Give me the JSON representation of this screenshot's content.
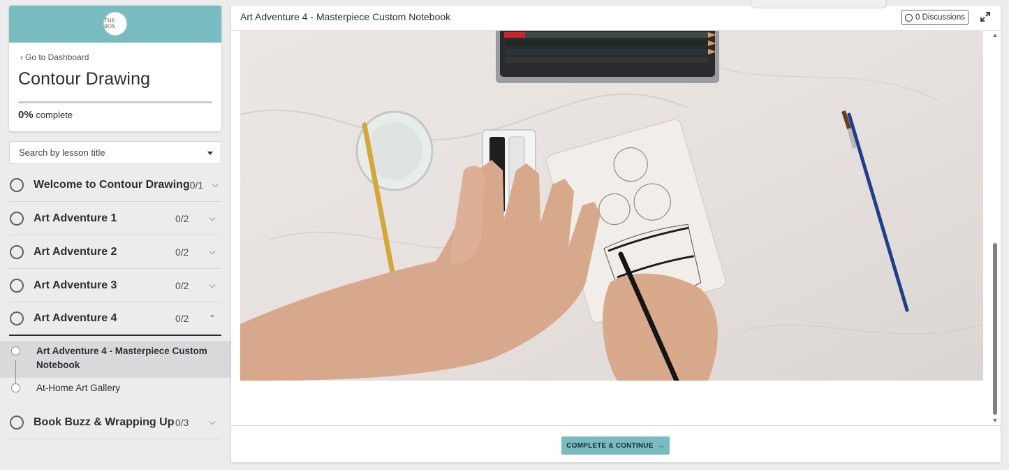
{
  "sidebar": {
    "logo_text": "THE BOX",
    "go_to_dashboard": "Go to Dashboard",
    "course_title": "Contour Drawing",
    "progress_percent": "0%",
    "progress_label": "complete",
    "progress_value": 0,
    "search_placeholder": "Search by lesson title",
    "sections": [
      {
        "title": "Welcome to Contour Drawing",
        "count": "0/1",
        "expanded": false
      },
      {
        "title": "Art Adventure 1",
        "count": "0/2",
        "expanded": false
      },
      {
        "title": "Art Adventure 2",
        "count": "0/2",
        "expanded": false
      },
      {
        "title": "Art Adventure 3",
        "count": "0/2",
        "expanded": false
      },
      {
        "title": "Art Adventure 4",
        "count": "0/2",
        "expanded": true
      },
      {
        "title": "Book Buzz & Wrapping Up",
        "count": "0/3",
        "expanded": false
      }
    ],
    "lessons": [
      {
        "title": "Art Adventure 4 - Masterpiece Custom Notebook",
        "active": true
      },
      {
        "title": "At-Home Art Gallery",
        "active": false
      }
    ]
  },
  "main": {
    "lesson_title": "Art Adventure 4 - Masterpiece Custom Notebook",
    "discussions_label": "0 Discussions",
    "complete_button": "COMPLETE & CONTINUE",
    "complete_arrow": "→"
  },
  "colors": {
    "accent": "#78bcc2",
    "text": "#2b2f33",
    "sidebar_bg": "#ececec",
    "active_lesson_bg": "#d7d9db"
  },
  "icons": {
    "back": "chevron-left-icon",
    "section_collapsed": "chevron-down-icon",
    "section_expanded": "chevron-up-icon",
    "discussions": "speech-bubble-icon",
    "fullscreen": "expand-icon",
    "continue": "arrow-right-icon"
  }
}
